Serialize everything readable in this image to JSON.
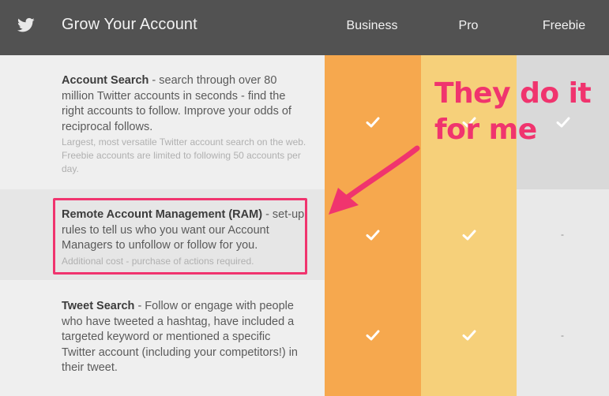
{
  "header": {
    "title": "Grow Your Account",
    "columns": [
      "Business",
      "Pro",
      "Freebie"
    ]
  },
  "features": [
    {
      "name": "Account Search",
      "description": " - search through over 80 million Twitter accounts in seconds - find the right accounts to follow. Improve your odds of reciprocal follows.",
      "note": "Largest, most versatile Twitter account search on the web. Freebie accounts are limited to following 50 accounts per day.",
      "availability": {
        "business": "check",
        "pro": "check",
        "freebie": "check"
      }
    },
    {
      "name": "Remote Account Management (RAM)",
      "description": " - set-up rules to tell us who you want our Account Managers to unfollow or follow for you.",
      "note": "Additional cost - purchase of actions required.",
      "availability": {
        "business": "check",
        "pro": "check",
        "freebie": "-"
      }
    },
    {
      "name": "Tweet Search",
      "description": " - Follow or engage with people who have tweeted a hashtag, have included a targeted keyword or mentioned a specific Twitter account (including your competitors!) in their tweet.",
      "note": "",
      "availability": {
        "business": "check",
        "pro": "check",
        "freebie": "-"
      }
    }
  ],
  "annotation": {
    "line1": "They do it",
    "line2": "for me",
    "color": "#f0346e"
  },
  "colors": {
    "header": "#525252",
    "business": "#f6a84e",
    "pro": "#f6d07a",
    "highlight": "#f0346e"
  }
}
